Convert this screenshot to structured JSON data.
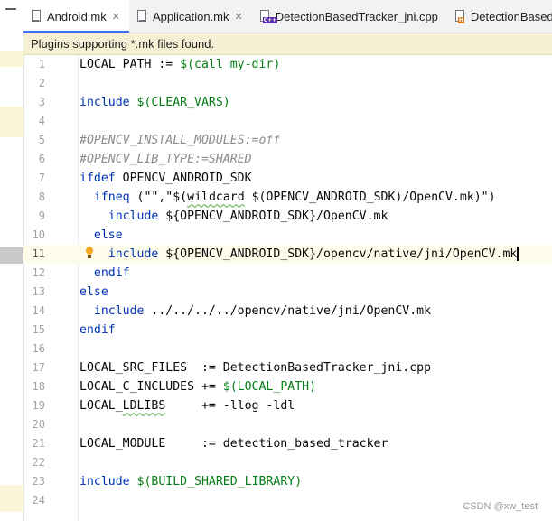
{
  "tabs": [
    {
      "label": "Android.mk",
      "icon": "makefile-icon",
      "active": true,
      "closable": true
    },
    {
      "label": "Application.mk",
      "icon": "makefile-icon",
      "active": false,
      "closable": true
    },
    {
      "label": "DetectionBasedTracker_jni.cpp",
      "icon": "cpp-file-icon",
      "tag": "C++",
      "active": false,
      "closable": false
    },
    {
      "label": "DetectionBasedTra",
      "icon": "header-file-icon",
      "tag": "H",
      "active": false,
      "closable": false
    }
  ],
  "notice": "Plugins supporting *.mk files found.",
  "editor": {
    "current_line": 11,
    "lines": [
      {
        "n": "1",
        "t": "LOCAL_PATH := $(call my-dir)"
      },
      {
        "n": "2",
        "t": ""
      },
      {
        "n": "3",
        "t": "include $(CLEAR_VARS)"
      },
      {
        "n": "4",
        "t": ""
      },
      {
        "n": "5",
        "t": "#OPENCV_INSTALL_MODULES:=off"
      },
      {
        "n": "6",
        "t": "#OPENCV_LIB_TYPE:=SHARED"
      },
      {
        "n": "7",
        "t": "ifdef OPENCV_ANDROID_SDK"
      },
      {
        "n": "8",
        "t": "  ifneq (\"\",\"$(wildcard $(OPENCV_ANDROID_SDK)/OpenCV.mk)\")"
      },
      {
        "n": "9",
        "t": "    include ${OPENCV_ANDROID_SDK}/OpenCV.mk"
      },
      {
        "n": "10",
        "t": "  else"
      },
      {
        "n": "11",
        "t": "    include ${OPENCV_ANDROID_SDK}/opencv/native/jni/OpenCV.mk"
      },
      {
        "n": "12",
        "t": "  endif"
      },
      {
        "n": "13",
        "t": "else"
      },
      {
        "n": "14",
        "t": "  include ../../../../opencv/native/jni/OpenCV.mk"
      },
      {
        "n": "15",
        "t": "endif"
      },
      {
        "n": "16",
        "t": ""
      },
      {
        "n": "17",
        "t": "LOCAL_SRC_FILES  := DetectionBasedTracker_jni.cpp"
      },
      {
        "n": "18",
        "t": "LOCAL_C_INCLUDES += $(LOCAL_PATH)"
      },
      {
        "n": "19",
        "t": "LOCAL_LDLIBS     += -llog -ldl"
      },
      {
        "n": "20",
        "t": ""
      },
      {
        "n": "21",
        "t": "LOCAL_MODULE     := detection_based_tracker"
      },
      {
        "n": "22",
        "t": ""
      },
      {
        "n": "23",
        "t": "include $(BUILD_SHARED_LIBRARY)"
      },
      {
        "n": "24",
        "t": ""
      }
    ]
  },
  "watermark": "CSDN @xw_test",
  "colors": {
    "keyword": "#0033b3",
    "variable": "#067d17",
    "comment": "#8c8c8c",
    "notice_bg": "#f5f0d4",
    "tab_underline": "#3574f0"
  }
}
